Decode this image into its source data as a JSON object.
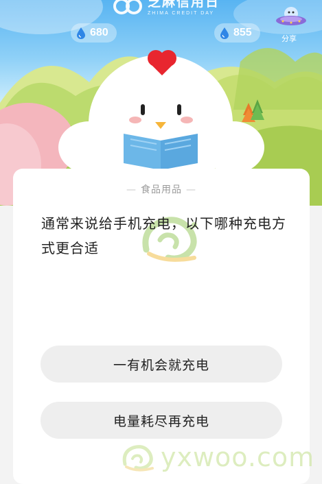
{
  "header": {
    "logo_text": "芝麻信用日",
    "logo_subtext": "ZHIMA CREDIT DAY",
    "energy_left": "680",
    "energy_right": "855",
    "share_label": "分享"
  },
  "quiz": {
    "category": "食品用品",
    "question": "通常来说给手机充电，以下哪种充电方式更合适",
    "options": [
      {
        "label": "一有机会就充电"
      },
      {
        "label": "电量耗尽再充电"
      }
    ]
  },
  "watermark": {
    "text": "yxwoo.com"
  },
  "colors": {
    "sky_top": "#58b4f2",
    "hill_green": "#c9e37a",
    "hen_comb": "#e8262f",
    "book_blue": "#6cb7e8",
    "option_bg": "#eeeeee"
  },
  "icons": [
    "water-drop-icon",
    "ufo-share-icon",
    "logo-mark-icon",
    "snail-watermark-icon"
  ]
}
